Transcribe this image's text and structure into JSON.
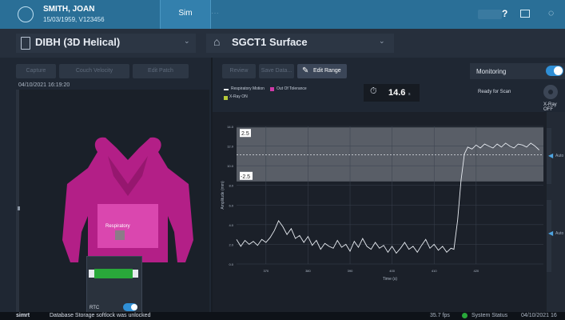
{
  "patient": {
    "name": "SMITH, JOAN",
    "info": "15/03/1959, V123456"
  },
  "tabs": {
    "sim": "Sim"
  },
  "selectors": {
    "plan": "DIBH (3D Helical)",
    "surface": "SGCT1 Surface"
  },
  "left_panel": {
    "buttons": {
      "capture": "Capture",
      "couch_velocity": "Couch Velocity",
      "edit_patch": "Edit Patch"
    },
    "timestamp": "04/10/2021 16:19:20",
    "region_label": "Respiratory",
    "rtc_label": "RTC"
  },
  "right_toolbar": {
    "review": "Review",
    "save_data": "Save Data...",
    "edit_range": "Edit Range"
  },
  "monitoring": {
    "label": "Monitoring",
    "on": true
  },
  "legend": {
    "respiratory": "Respiratory Motion",
    "out_of_tolerance": "Out Of Tolerance",
    "xray": "X-Ray ON"
  },
  "timer": {
    "value": "14.6",
    "unit": "s"
  },
  "ready_label": "Ready for Scan",
  "xray_state": "X-Ray OFF",
  "status_bar": {
    "logo": "simrt",
    "message": "Database Storage softlock was unlocked",
    "fps": "35.7 fps",
    "system": "System Status",
    "date": "04/10/2021 16"
  },
  "rail": {
    "auto": "Auto"
  },
  "colors": {
    "accent": "#2a6f97",
    "trace": "#e8ecf2",
    "tolerance_band": "#595e67",
    "out_of_tolerance": "#cf3aa8",
    "ok": "#29a83a"
  },
  "chart_data": {
    "type": "line",
    "title": "",
    "xlabel": "Time (s)",
    "ylabel": "Amplitude (mm)",
    "x_ticks": [
      "370",
      "380",
      "390",
      "400",
      "410",
      "420"
    ],
    "y_ticks": [
      "0.0",
      "2.0",
      "4.0",
      "6.0",
      "8.0",
      "10.0",
      "12.0",
      "14.0"
    ],
    "ylim": [
      0,
      14
    ],
    "tolerance_upper_label": "2.5",
    "tolerance_lower_label": "-2.5",
    "tolerance_band": [
      8.4,
      13.9
    ],
    "target_level": 11.1,
    "series": [
      {
        "values": [
          [
            363,
            2.5
          ],
          [
            364,
            1.8
          ],
          [
            365,
            2.4
          ],
          [
            366,
            2.0
          ],
          [
            367,
            2.3
          ],
          [
            368,
            1.9
          ],
          [
            369,
            2.5
          ],
          [
            370,
            2.2
          ],
          [
            371,
            2.7
          ],
          [
            372,
            3.4
          ],
          [
            373,
            4.4
          ],
          [
            374,
            3.8
          ],
          [
            375,
            3.0
          ],
          [
            376,
            3.6
          ],
          [
            377,
            2.6
          ],
          [
            378,
            2.9
          ],
          [
            379,
            2.2
          ],
          [
            380,
            2.8
          ],
          [
            381,
            1.9
          ],
          [
            382,
            2.4
          ],
          [
            383,
            1.5
          ],
          [
            384,
            2.1
          ],
          [
            385,
            1.8
          ],
          [
            386,
            1.6
          ],
          [
            387,
            2.4
          ],
          [
            388,
            1.7
          ],
          [
            389,
            2.0
          ],
          [
            390,
            1.3
          ],
          [
            391,
            2.3
          ],
          [
            392,
            1.7
          ],
          [
            393,
            2.6
          ],
          [
            394,
            1.8
          ],
          [
            395,
            1.5
          ],
          [
            396,
            2.2
          ],
          [
            397,
            1.6
          ],
          [
            398,
            1.9
          ],
          [
            399,
            1.2
          ],
          [
            400,
            1.8
          ],
          [
            401,
            1.1
          ],
          [
            402,
            1.6
          ],
          [
            403,
            2.2
          ],
          [
            404,
            1.5
          ],
          [
            405,
            1.8
          ],
          [
            406,
            1.2
          ],
          [
            407,
            1.9
          ],
          [
            408,
            2.5
          ],
          [
            409,
            1.6
          ],
          [
            410,
            2.0
          ],
          [
            411,
            1.4
          ],
          [
            412,
            1.8
          ],
          [
            413,
            1.2
          ],
          [
            414,
            1.6
          ],
          [
            414.7,
            1.5
          ],
          [
            415.6,
            4.5
          ],
          [
            416.4,
            8.5
          ],
          [
            417.2,
            11.2
          ],
          [
            418,
            11.9
          ],
          [
            419,
            11.7
          ],
          [
            420,
            12.1
          ],
          [
            421,
            11.8
          ],
          [
            422,
            12.2
          ],
          [
            423,
            12.0
          ],
          [
            424,
            11.8
          ],
          [
            425,
            12.2
          ],
          [
            426,
            11.9
          ],
          [
            427,
            12.3
          ],
          [
            428,
            12.0
          ],
          [
            429,
            11.8
          ],
          [
            430,
            12.2
          ],
          [
            431,
            12.1
          ],
          [
            432,
            11.9
          ],
          [
            433,
            12.3
          ],
          [
            434,
            12.0
          ],
          [
            435,
            11.6
          ]
        ]
      }
    ],
    "grid": true
  }
}
